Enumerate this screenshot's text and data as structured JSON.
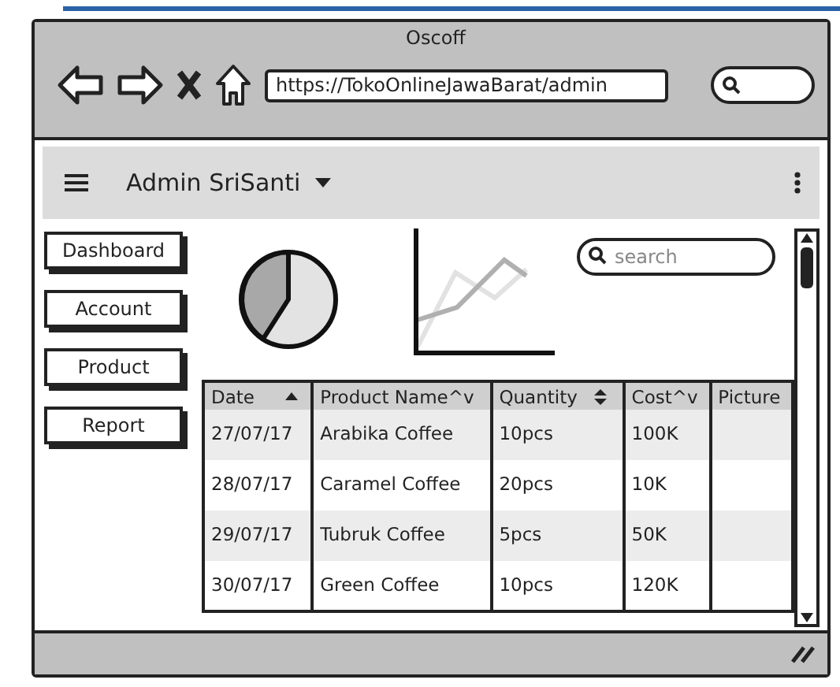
{
  "window": {
    "title": "Oscoff",
    "url": "https://TokoOnlineJawaBarat/admin"
  },
  "navbar": {
    "title": "Admin SriSanti"
  },
  "sidebar": {
    "items": [
      {
        "label": "Dashboard"
      },
      {
        "label": "Account"
      },
      {
        "label": "Product"
      },
      {
        "label": "Report"
      }
    ]
  },
  "search": {
    "placeholder": "search"
  },
  "table": {
    "columns": [
      {
        "label": "Date",
        "sorted_up": true,
        "sort_arrows": false
      },
      {
        "label": "Product Name^v",
        "sorted_up": false,
        "sort_arrows": false
      },
      {
        "label": "Quantity",
        "sorted_up": false,
        "sort_arrows": true
      },
      {
        "label": "Cost^v",
        "sorted_up": false,
        "sort_arrows": false
      },
      {
        "label": "Picture",
        "sorted_up": false,
        "sort_arrows": false
      }
    ],
    "rows": [
      [
        "27/07/17",
        "Arabika Coffee",
        "10pcs",
        "100K"
      ],
      [
        "28/07/17",
        "Caramel Coffee",
        "20pcs",
        "10K"
      ],
      [
        "29/07/17",
        "Tubruk Coffee",
        "5pcs",
        "50K"
      ],
      [
        "30/07/17",
        "Green Coffee",
        "10pcs",
        "120K"
      ]
    ]
  }
}
